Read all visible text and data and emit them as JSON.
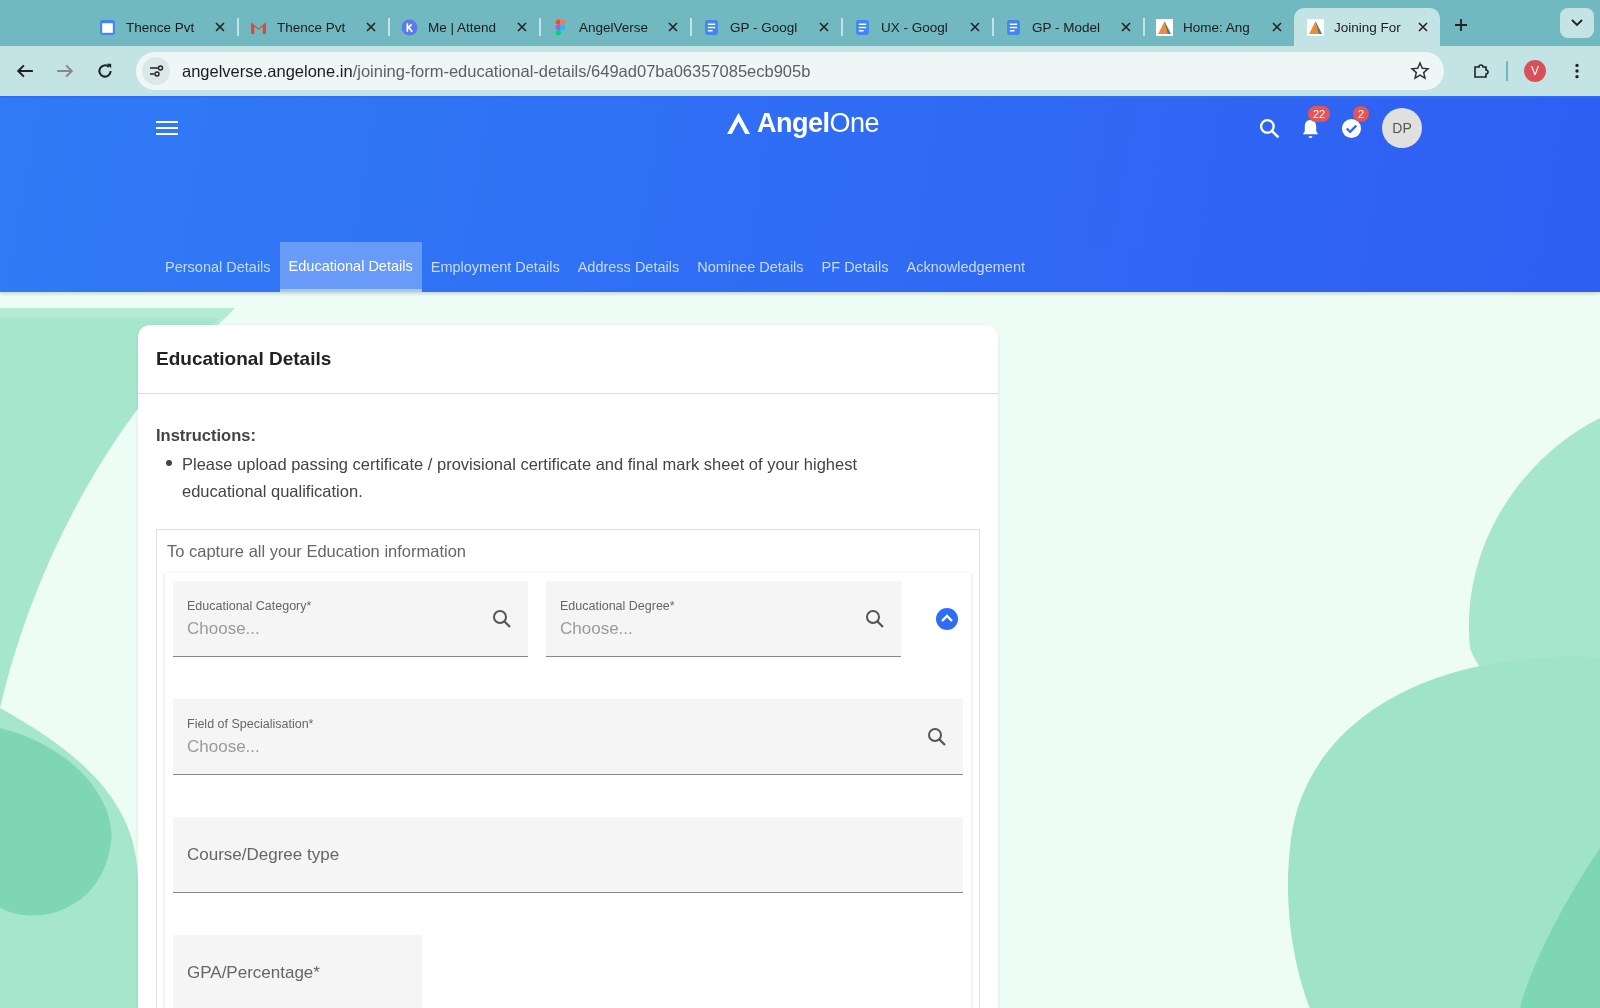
{
  "browser": {
    "tabs": [
      {
        "title": "Thence Pvt",
        "selected": false
      },
      {
        "title": "Thence Pvt",
        "selected": false
      },
      {
        "title": "Me | Attend",
        "selected": false
      },
      {
        "title": "AngelVerse",
        "selected": false
      },
      {
        "title": "GP - Googl",
        "selected": false
      },
      {
        "title": "UX - Googl",
        "selected": false
      },
      {
        "title": "GP - Model",
        "selected": false
      },
      {
        "title": "Home: Ang",
        "selected": false
      },
      {
        "title": "Joining For",
        "selected": true
      }
    ],
    "url_host": "angelverse.angelone.in",
    "url_path": "/joining-form-educational-details/649ad07ba06357085ecb905b",
    "profile": "V"
  },
  "header": {
    "logo": "**Angel**One",
    "notifications": "22",
    "tasks": "2",
    "avatar": "DP"
  },
  "nav": [
    {
      "label": "Personal Details",
      "selected": false
    },
    {
      "label": "Educational Details",
      "selected": true
    },
    {
      "label": "Employment Details",
      "selected": false
    },
    {
      "label": "Address Details",
      "selected": false
    },
    {
      "label": "Nominee Details",
      "selected": false
    },
    {
      "label": "PF Details",
      "selected": false
    },
    {
      "label": "Acknowledgement",
      "selected": false
    }
  ],
  "card": {
    "title": "Educational Details",
    "instructions_label": "Instructions:",
    "instructions": [
      "Please upload passing certificate / provisional certificate and final mark sheet of your highest educational qualification."
    ],
    "section_title": "To capture all your Education information",
    "rows": [
      {
        "collapse": true,
        "fields": [
          {
            "kind": "search",
            "label": "Educational Category*",
            "placeholder": "Choose..."
          },
          {
            "kind": "search",
            "label": "Educational Degree*",
            "placeholder": "Choose..."
          }
        ]
      },
      {
        "collapse": false,
        "fields": [
          {
            "kind": "search",
            "label": "Field of Specialisation*",
            "placeholder": "Choose..."
          }
        ]
      },
      {
        "collapse": false,
        "fields": [
          {
            "kind": "text",
            "placeholder": "Course/Degree type"
          }
        ]
      },
      {
        "collapse": false,
        "fields": [
          {
            "kind": "short",
            "placeholder": "GPA/Percentage*"
          }
        ]
      }
    ]
  }
}
